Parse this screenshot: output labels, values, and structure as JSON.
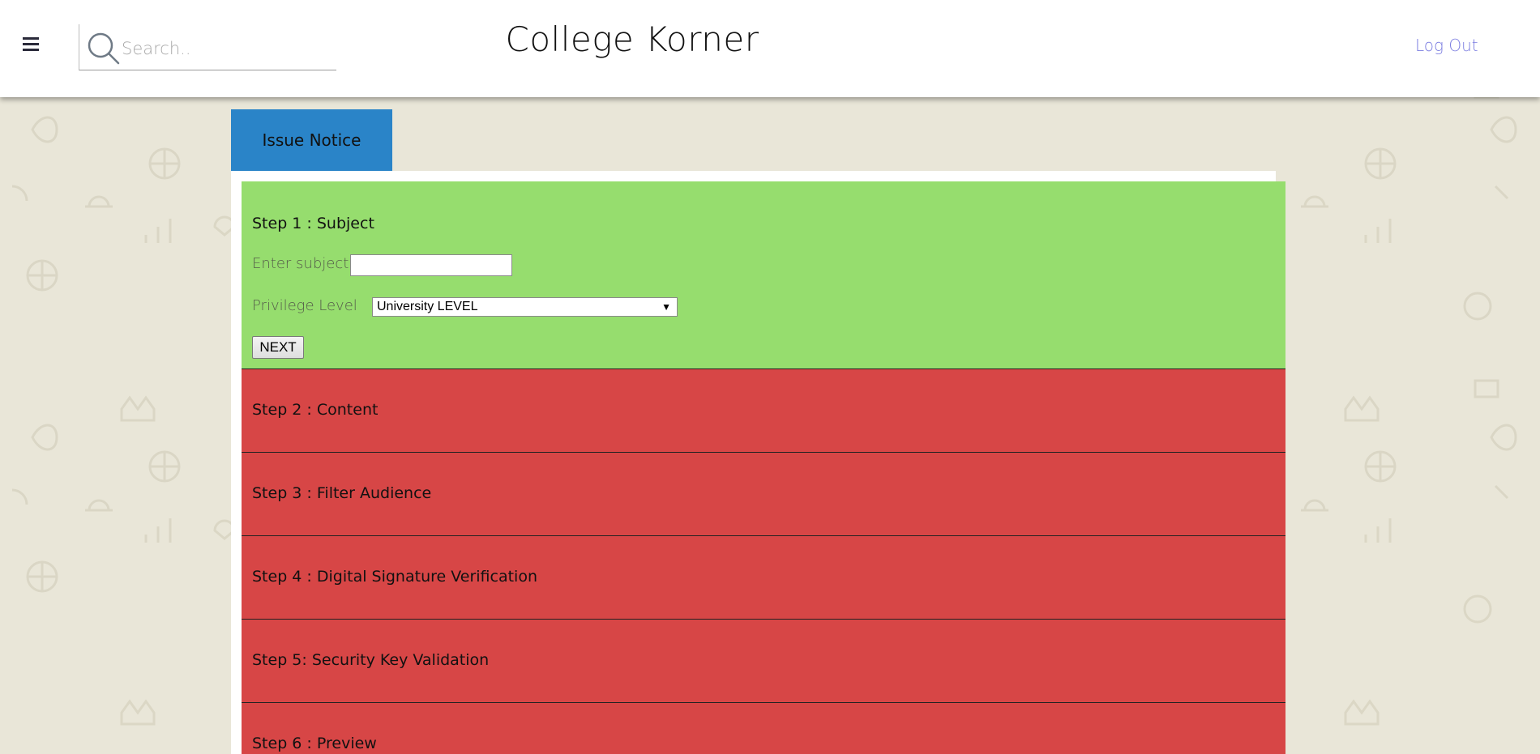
{
  "header": {
    "app_title": "College Korner",
    "search_placeholder": "Search..",
    "logout_label": "Log Out"
  },
  "tab": {
    "label": "Issue Notice"
  },
  "steps": [
    {
      "title": "Step 1 : Subject",
      "status_color": "#96dd6e",
      "fields": {
        "subject_label": "Enter subject :",
        "subject_value": "",
        "privilege_label": "Privilege Level",
        "privilege_selected": "University LEVEL"
      },
      "next_label": "NEXT"
    },
    {
      "title": "Step 2 : Content",
      "status_color": "#d74646"
    },
    {
      "title": "Step 3 : Filter Audience",
      "status_color": "#d74646"
    },
    {
      "title": "Step 4 : Digital Signature Verification",
      "status_color": "#d74646"
    },
    {
      "title": "Step 5: Security Key Validation",
      "status_color": "#d74646"
    },
    {
      "title": "Step 6 : Preview",
      "status_color": "#d74646"
    }
  ],
  "colors": {
    "accent_tab": "#2a84c8",
    "logout_link": "#7a7ce0",
    "active_step": "#96dd6e",
    "pending_step": "#d74646",
    "background": "#e9e6d8"
  }
}
